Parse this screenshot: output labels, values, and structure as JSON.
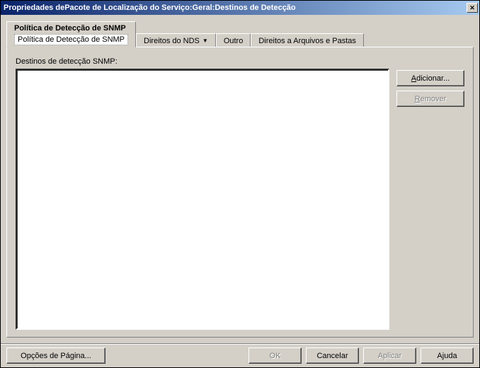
{
  "window": {
    "title": "Propriedades dePacote de Localização do Serviço:Geral:Destinos de Detecção"
  },
  "tabs": {
    "active": {
      "title": "Política de Detecção de SNMP",
      "sub": "Política de Detecção de SNMP"
    },
    "items": [
      {
        "label": "Direitos do NDS",
        "hasDropdown": true
      },
      {
        "label": "Outro"
      },
      {
        "label": "Direitos a Arquivos e Pastas"
      }
    ]
  },
  "main": {
    "list_label": "Destinos de detecção SNMP:",
    "buttons": {
      "add": "Adicionar...",
      "remove": "Remover"
    }
  },
  "footer": {
    "page_options": "Opções de Página...",
    "ok": "OK",
    "cancel": "Cancelar",
    "apply": "Aplicar",
    "help": "Ajuda"
  }
}
